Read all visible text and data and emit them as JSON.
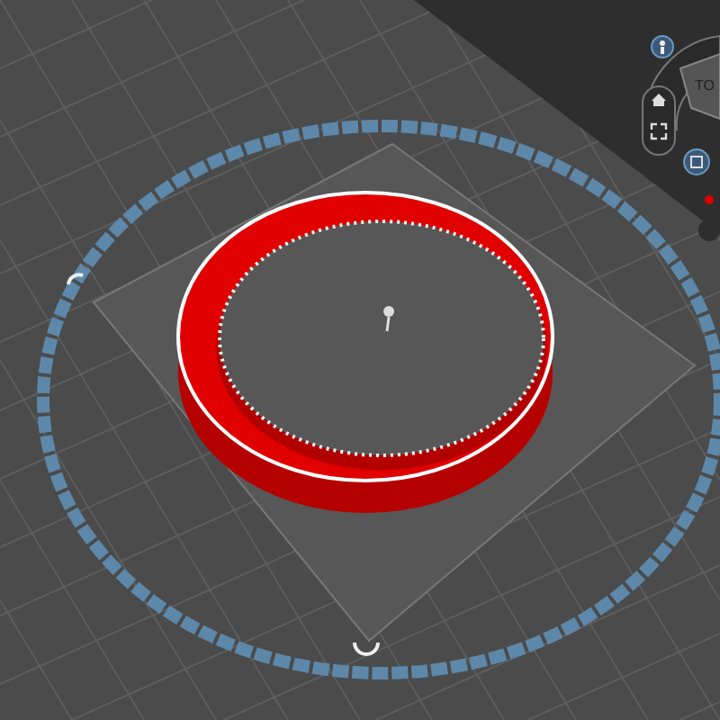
{
  "view_cube": {
    "label": "TO"
  }
}
